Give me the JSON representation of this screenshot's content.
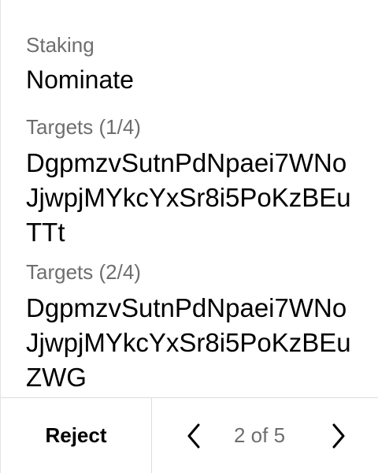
{
  "details": {
    "section_label": "Staking",
    "action": "Nominate",
    "targets": [
      {
        "label": "Targets (1/4)",
        "address": "DgpmzvSutnPdNpaei7WNoJjwpjMYkcYxSr8i5PoKzBEuTTt"
      },
      {
        "label": "Targets (2/4)",
        "address": "DgpmzvSutnPdNpaei7WNoJjwpjMYkcYxSr8i5PoKzBEuZWG"
      }
    ]
  },
  "footer": {
    "reject_label": "Reject",
    "page_indicator": "2 of 5",
    "prev_icon": "chevron-left-icon",
    "next_icon": "chevron-right-icon"
  },
  "colors": {
    "label": "#6e6e6e",
    "value": "#000000",
    "divider": "#dcdcdc"
  }
}
